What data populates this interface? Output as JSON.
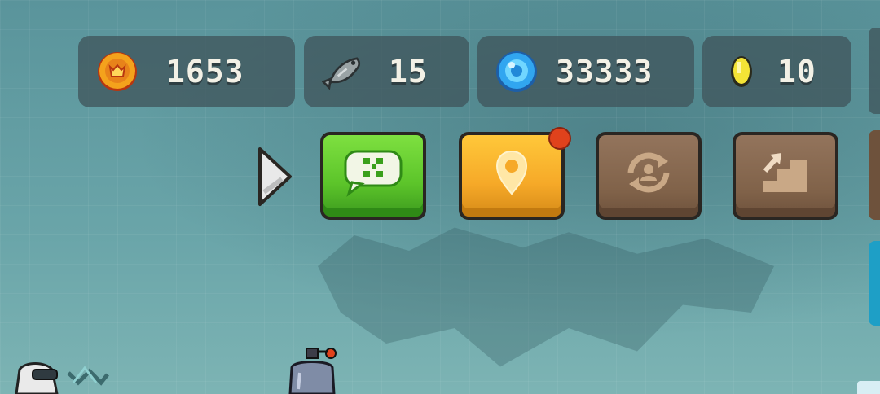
{
  "hud": {
    "currencies": [
      {
        "id": "gold",
        "icon": "gold-coin-icon",
        "value": "1653"
      },
      {
        "id": "fish",
        "icon": "fish-icon",
        "value": "15"
      },
      {
        "id": "gem",
        "icon": "blue-gem-icon",
        "value": "33333"
      },
      {
        "id": "coin",
        "icon": "yellow-coin-icon",
        "value": "10"
      }
    ]
  },
  "actions": {
    "buttons": [
      {
        "id": "qr",
        "icon": "qr-chat-icon",
        "color": "#5cc42a"
      },
      {
        "id": "location",
        "icon": "location-pin-icon",
        "color": "#f6a928",
        "notification": true
      },
      {
        "id": "swap",
        "icon": "character-swap-icon",
        "color": "#806249"
      },
      {
        "id": "upgrade",
        "icon": "stairs-up-icon",
        "color": "#806249"
      }
    ],
    "expand_icon": "triangle-right-icon"
  },
  "colors": {
    "background": "#5f9aa0",
    "panel": "#40565c",
    "text": "#f3f1e6",
    "notification": "#e0421c"
  }
}
